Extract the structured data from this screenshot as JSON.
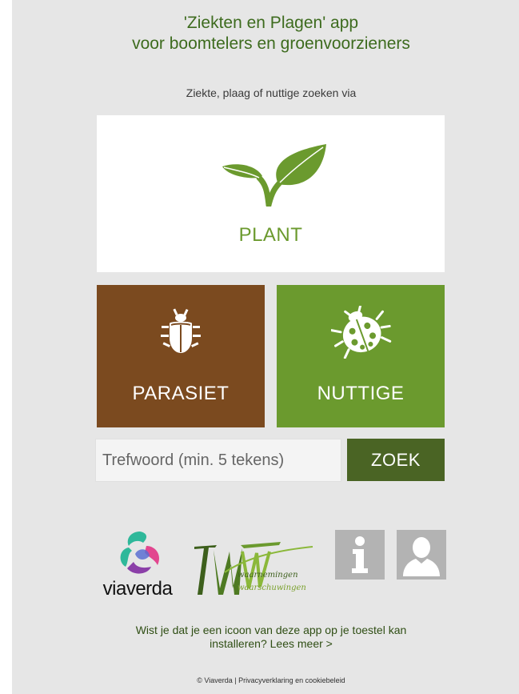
{
  "header": {
    "title_line1": "'Ziekten en Plagen' app",
    "title_line2": "voor boomtelers en groenvoorzieners",
    "subtitle": "Ziekte, plaag of nuttige zoeken via"
  },
  "tiles": {
    "plant": {
      "label": "PLANT",
      "icon": "plant-sprout-icon",
      "color": "#6b9a2e"
    },
    "parasiet": {
      "label": "PARASIET",
      "icon": "bug-icon",
      "color": "#7b4a1f"
    },
    "nuttige": {
      "label": "NUTTIGE",
      "icon": "ladybug-icon",
      "color": "#6b9a2e"
    }
  },
  "search": {
    "placeholder": "Trefwoord (min. 5 tekens)",
    "value": "",
    "button_label": "ZOEK",
    "button_color": "#4a6424"
  },
  "logos": {
    "viaverda": "viaverda",
    "ww_line1": "waarnemingen",
    "ww_line2": "waarschuwingen",
    "ww_letters": "WW"
  },
  "icons": {
    "info": "info-icon",
    "user": "user-icon"
  },
  "install_tip": {
    "text_line1": "Wist je dat je een icoon van deze app op je toestel kan",
    "text_line2": "installeren?",
    "link": "Lees meer >"
  },
  "footer": {
    "copyright": "© Viaverda",
    "separator": " | ",
    "privacy_link": "Privacyverklaring en cookiebeleid"
  }
}
